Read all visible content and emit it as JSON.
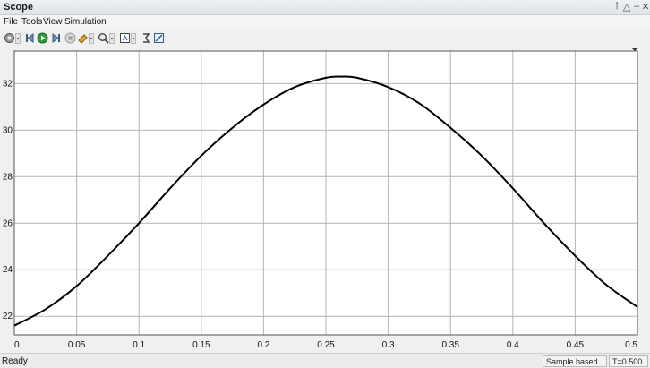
{
  "window": {
    "title": "Scope",
    "controls": [
      "pin-icon",
      "undock-icon",
      "minimize-icon",
      "close-icon"
    ]
  },
  "menu": [
    "File",
    "Tools",
    "View",
    "Simulation"
  ],
  "toolbar": {
    "icons": [
      "settings-icon",
      "step-back-icon",
      "run-icon",
      "step-forward-icon",
      "stop-icon",
      "highlight-icon",
      "zoom-icon",
      "fit-axes-icon",
      "signal-select-icon",
      "edit-icon"
    ]
  },
  "chart_data": {
    "type": "line",
    "xlim": [
      0,
      0.5
    ],
    "ylim": [
      21.2,
      33.4
    ],
    "xticks": [
      0,
      0.05,
      0.1,
      0.15,
      0.2,
      0.25,
      0.3,
      0.35,
      0.4,
      0.45,
      0.5
    ],
    "yticks": [
      22,
      24,
      26,
      28,
      30,
      32
    ],
    "xtick_labels": [
      "0",
      "0.05",
      "0.1",
      "0.15",
      "0.2",
      "0.25",
      "0.3",
      "0.35",
      "0.4",
      "0.45",
      "0.5"
    ],
    "ytick_labels": [
      "22",
      "24",
      "26",
      "28",
      "30",
      "32"
    ],
    "grid": true,
    "series": [
      {
        "color": "#000000",
        "x": [
          0,
          0.025,
          0.05,
          0.075,
          0.1,
          0.125,
          0.15,
          0.175,
          0.2,
          0.225,
          0.25,
          0.2625,
          0.275,
          0.3,
          0.325,
          0.35,
          0.375,
          0.4,
          0.425,
          0.45,
          0.475,
          0.5
        ],
        "y": [
          21.6,
          22.3,
          23.3,
          24.6,
          26.0,
          27.5,
          28.9,
          30.1,
          31.1,
          31.85,
          32.25,
          32.3,
          32.25,
          31.85,
          31.15,
          30.1,
          28.9,
          27.5,
          26.0,
          24.6,
          23.35,
          22.4
        ]
      }
    ]
  },
  "status": {
    "text": "Ready",
    "mode": "Sample based",
    "time": "T=0.500"
  }
}
